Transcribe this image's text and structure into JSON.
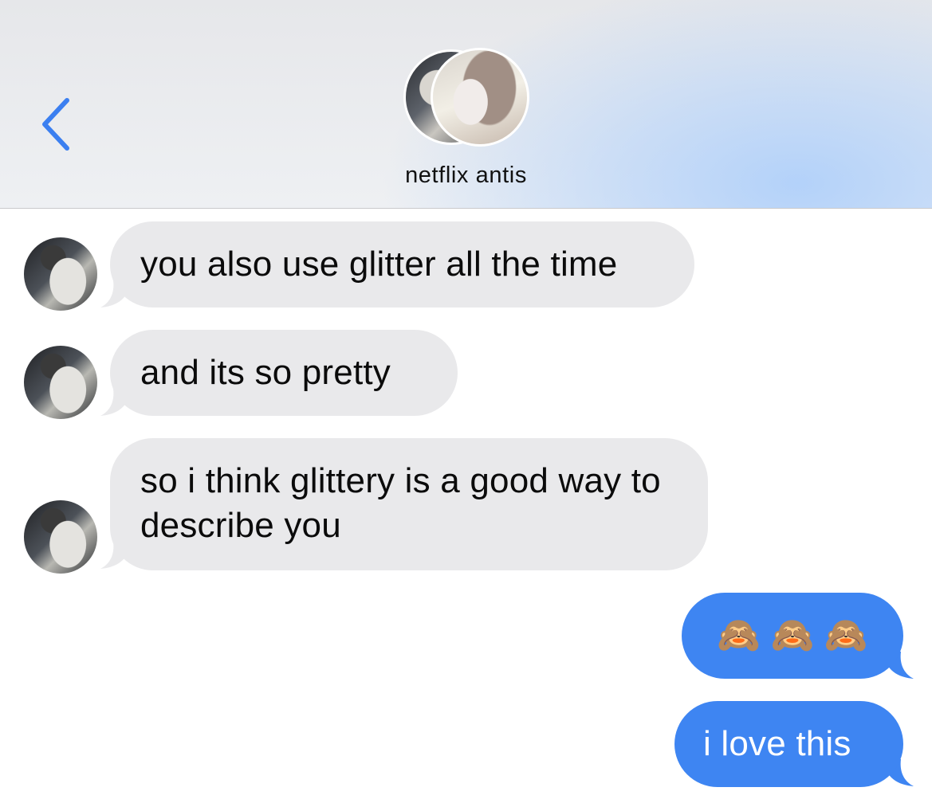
{
  "header": {
    "back_icon": "chevron-left-icon",
    "group_name": "netflix antis",
    "accent_color": "#3b7ff0"
  },
  "messages": [
    {
      "direction": "incoming",
      "text": "you also use glitter all the time"
    },
    {
      "direction": "incoming",
      "text": "and its so pretty"
    },
    {
      "direction": "incoming",
      "text": "so i think glittery is a good way to describe you"
    },
    {
      "direction": "outgoing",
      "text": "🙈 🙈 🙈"
    },
    {
      "direction": "outgoing",
      "text": "i love this"
    }
  ],
  "colors": {
    "incoming_bubble": "#e9e9eb",
    "outgoing_bubble": "#3e85f2"
  }
}
